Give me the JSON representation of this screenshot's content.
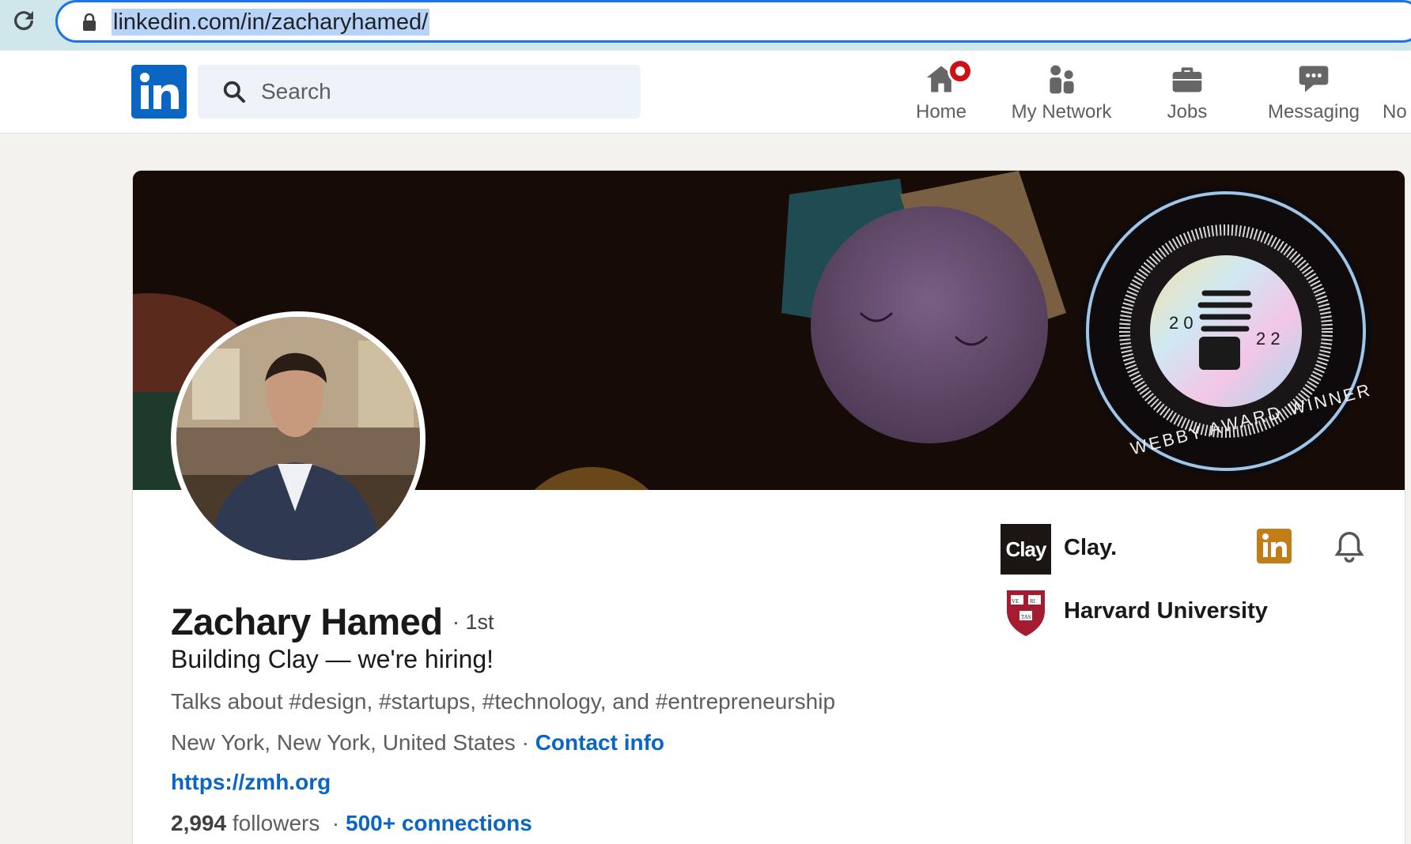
{
  "browser": {
    "url": "linkedin.com/in/zacharyhamed/"
  },
  "nav": {
    "logo_text": "in",
    "search_placeholder": "Search",
    "items": [
      {
        "label": "Home",
        "icon": "home-icon"
      },
      {
        "label": "My Network",
        "icon": "network-icon"
      },
      {
        "label": "Jobs",
        "icon": "briefcase-icon"
      },
      {
        "label": "Messaging",
        "icon": "messaging-icon"
      },
      {
        "label": "No",
        "icon": "notifications-icon"
      }
    ],
    "home_has_notification": true
  },
  "banner": {
    "badge": {
      "text": "WEBBY AWARD WINNER",
      "year_left": "2 0",
      "year_right": "2 2"
    }
  },
  "profile": {
    "name": "Zachary Hamed",
    "degree": "· 1st",
    "headline": "Building Clay — we're hiring!",
    "talks_about": "Talks about #design, #startups, #technology, and #entrepreneurship",
    "location": "New York, New York, United States",
    "separator": "·",
    "contact_info": "Contact info",
    "website": "https://zmh.org",
    "followers_count": "2,994",
    "followers_label": "followers",
    "stats_separator": "·",
    "connections": "500+ connections"
  },
  "orgs": [
    {
      "name": "Clay.",
      "logo_text": "Clay"
    },
    {
      "name": "Harvard University",
      "logo_text": "VE RI TAS"
    }
  ],
  "colors": {
    "linkedin_blue": "#0a66c2",
    "premium_gold": "#c37d16",
    "notification_red": "#cc1016"
  }
}
